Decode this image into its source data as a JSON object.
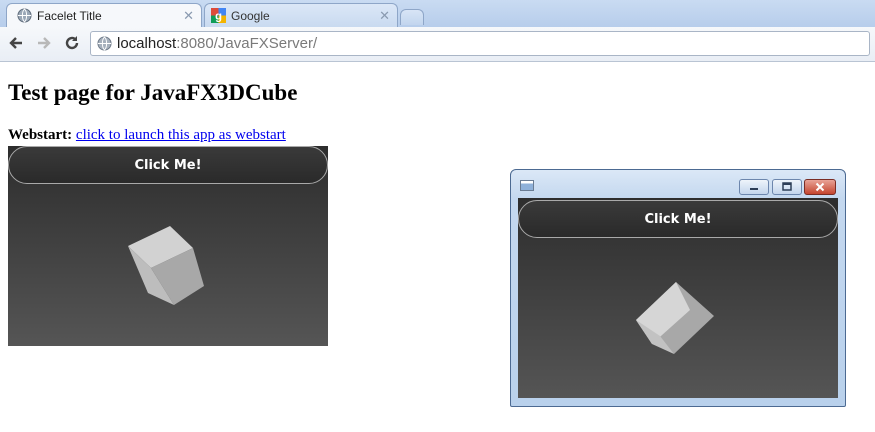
{
  "browser": {
    "tabs": [
      {
        "title": "Facelet Title",
        "active": true,
        "icon": "globe-icon"
      },
      {
        "title": "Google",
        "active": false,
        "icon": "google-icon"
      }
    ],
    "url_host": "localhost",
    "url_rest": ":8080/JavaFXServer/"
  },
  "page": {
    "heading": "Test page for JavaFX3DCube",
    "webstart_label": "Webstart:",
    "webstart_link": "click to launch this app as webstart"
  },
  "embedded_app": {
    "button_label": "Click Me!"
  },
  "popup_window": {
    "button_label": "Click Me!",
    "controls": [
      "minimize",
      "maximize",
      "close"
    ]
  },
  "colors": {
    "link": "#0000ee",
    "scene_top": "#2d2d2d",
    "scene_bottom": "#555555",
    "cube_light": "#d2d2d2",
    "cube_mid": "#bdbdbd",
    "cube_dark": "#a5a5a5",
    "close_button": "#c4452f"
  }
}
